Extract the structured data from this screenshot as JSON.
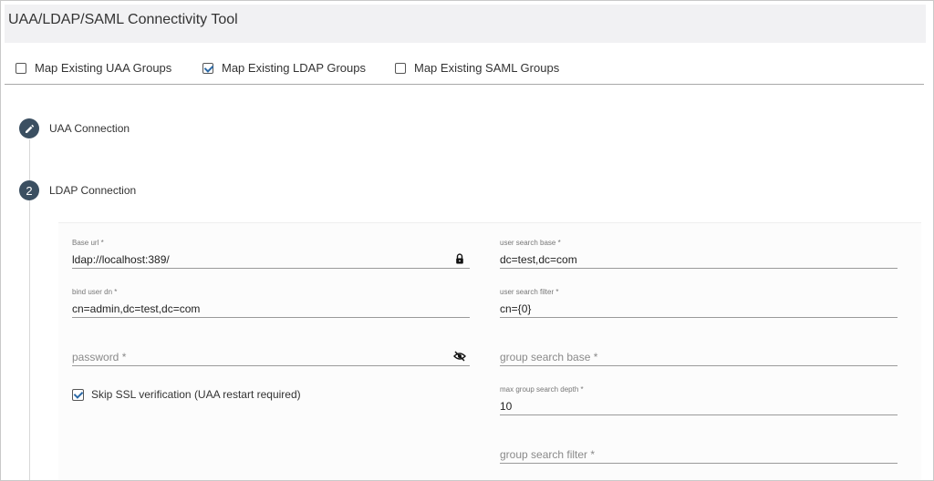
{
  "app": {
    "title": "UAA/LDAP/SAML Connectivity Tool"
  },
  "map_options": [
    {
      "label": "Map Existing UAA Groups",
      "checked": false
    },
    {
      "label": "Map Existing LDAP Groups",
      "checked": true
    },
    {
      "label": "Map Existing SAML Groups",
      "checked": false
    }
  ],
  "steps": [
    {
      "label": "UAA Connection",
      "icon": "pencil-icon"
    },
    {
      "label": "LDAP Connection",
      "number": "2"
    }
  ],
  "form": {
    "base_url": {
      "label": "Base url *",
      "value": "ldap://localhost:389/",
      "icon": "lock-icon"
    },
    "bind_user_dn": {
      "label": "bind user dn *",
      "value": "cn=admin,dc=test,dc=com"
    },
    "password": {
      "placeholder": "password *",
      "icon": "eye-off-icon"
    },
    "skip_ssl": {
      "label": "Skip SSL verification (UAA restart required)",
      "checked": true
    },
    "user_search_base": {
      "label": "user search base *",
      "value": "dc=test,dc=com"
    },
    "user_search_filter": {
      "label": "user search filter *",
      "value": "cn={0}"
    },
    "group_search_base": {
      "placeholder": "group search base *"
    },
    "max_group_search_depth": {
      "label": "max group search depth *",
      "value": "10"
    },
    "group_search_filter": {
      "placeholder": "group search filter *"
    }
  },
  "colors": {
    "step_circle": "#3b4f61",
    "check_accent": "#2d6aa6",
    "header_bg": "#f1f1f3"
  }
}
